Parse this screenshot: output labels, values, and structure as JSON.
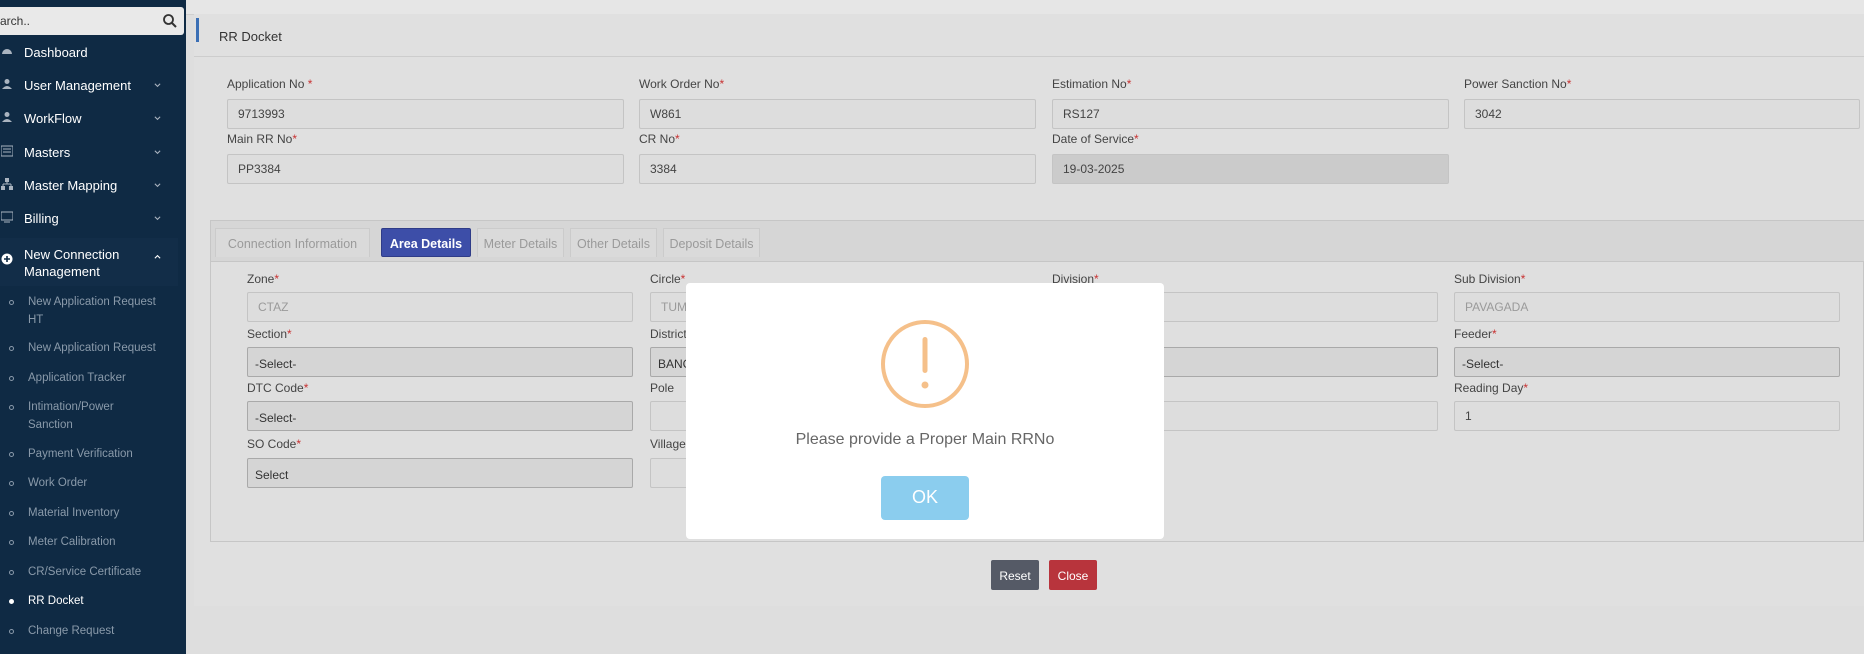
{
  "sidebar": {
    "search": {
      "placeholder": "Search..",
      "value": "arch.."
    },
    "menu": [
      {
        "label": "Dashboard",
        "icon": "dashboard-icon"
      },
      {
        "label": "User Management",
        "icon": "user-icon"
      },
      {
        "label": "WorkFlow",
        "icon": "user-icon"
      },
      {
        "label": "Masters",
        "icon": "list-icon"
      },
      {
        "label": "Master Mapping",
        "icon": "sitemap-icon"
      },
      {
        "label": "Billing",
        "icon": "monitor-icon"
      },
      {
        "label": "New Connection",
        "label2": "Management",
        "icon": "plus-circle-icon"
      }
    ],
    "submenu": [
      {
        "label": "New Application Request",
        "label2": "HT"
      },
      {
        "label": "New Application Request"
      },
      {
        "label": "Application Tracker"
      },
      {
        "label": "Intimation/Power",
        "label2": "Sanction"
      },
      {
        "label": "Payment Verification"
      },
      {
        "label": "Work Order"
      },
      {
        "label": "Material Inventory"
      },
      {
        "label": "Meter Calibration"
      },
      {
        "label": "CR/Service Certificate"
      },
      {
        "label": "RR Docket"
      },
      {
        "label": "Change Request"
      }
    ]
  },
  "page": {
    "title": "RR Docket"
  },
  "form": {
    "application_no": {
      "label": "Application No",
      "req": " *",
      "value": "9713993"
    },
    "work_order_no": {
      "label": "Work Order No",
      "req": "*",
      "value": "W861"
    },
    "estimation_no": {
      "label": "Estimation No",
      "req": "*",
      "value": "RS127"
    },
    "power_sanction_no": {
      "label": "Power Sanction No",
      "req": "*",
      "value": "3042"
    },
    "main_rr_no": {
      "label": "Main RR No",
      "req": "*",
      "value": "PP3384"
    },
    "cr_no": {
      "label": "CR No",
      "req": "*",
      "value": "3384"
    },
    "date_of_service": {
      "label": "Date of Service",
      "req": "*",
      "value": "19-03-2025"
    }
  },
  "tabs": [
    "Connection Information",
    "Area Details",
    "Meter Details",
    "Other Details",
    "Deposit Details"
  ],
  "area": {
    "zone": {
      "label": "Zone",
      "req": "*",
      "value": "CTAZ"
    },
    "circle": {
      "label": "Circle",
      "req": "*",
      "value": "TUMK"
    },
    "division": {
      "label": "Division",
      "req": "*"
    },
    "sub_division": {
      "label": "Sub Division",
      "req": "*",
      "value": "PAVAGADA"
    },
    "section": {
      "label": "Section",
      "req": "*",
      "value": "-Select-"
    },
    "district": {
      "label": "District",
      "value": "BANG"
    },
    "feeder": {
      "label": "Feeder",
      "req": "*",
      "value": "-Select-"
    },
    "dtc_code": {
      "label": "DTC Code",
      "req": "*",
      "value": "-Select-"
    },
    "pole": {
      "label": "Pole"
    },
    "reading_day": {
      "label": "Reading Day",
      "req": "*",
      "value": "1"
    },
    "so_code": {
      "label": "SO Code",
      "req": "*",
      "value": "Select"
    },
    "village": {
      "label": "Village"
    }
  },
  "buttons": {
    "reset": "Reset",
    "close": "Close"
  },
  "colors": {
    "sidebar": "#0f2a44",
    "tab_active": "#3d4ea8",
    "close": "#c82333",
    "reset": "#5a6268",
    "ok": "#8bcdee",
    "warning": "#f5c08a"
  },
  "modal": {
    "icon": "warning-circle-icon",
    "message": "Please provide a Proper Main RRNo",
    "ok_label": "OK"
  }
}
